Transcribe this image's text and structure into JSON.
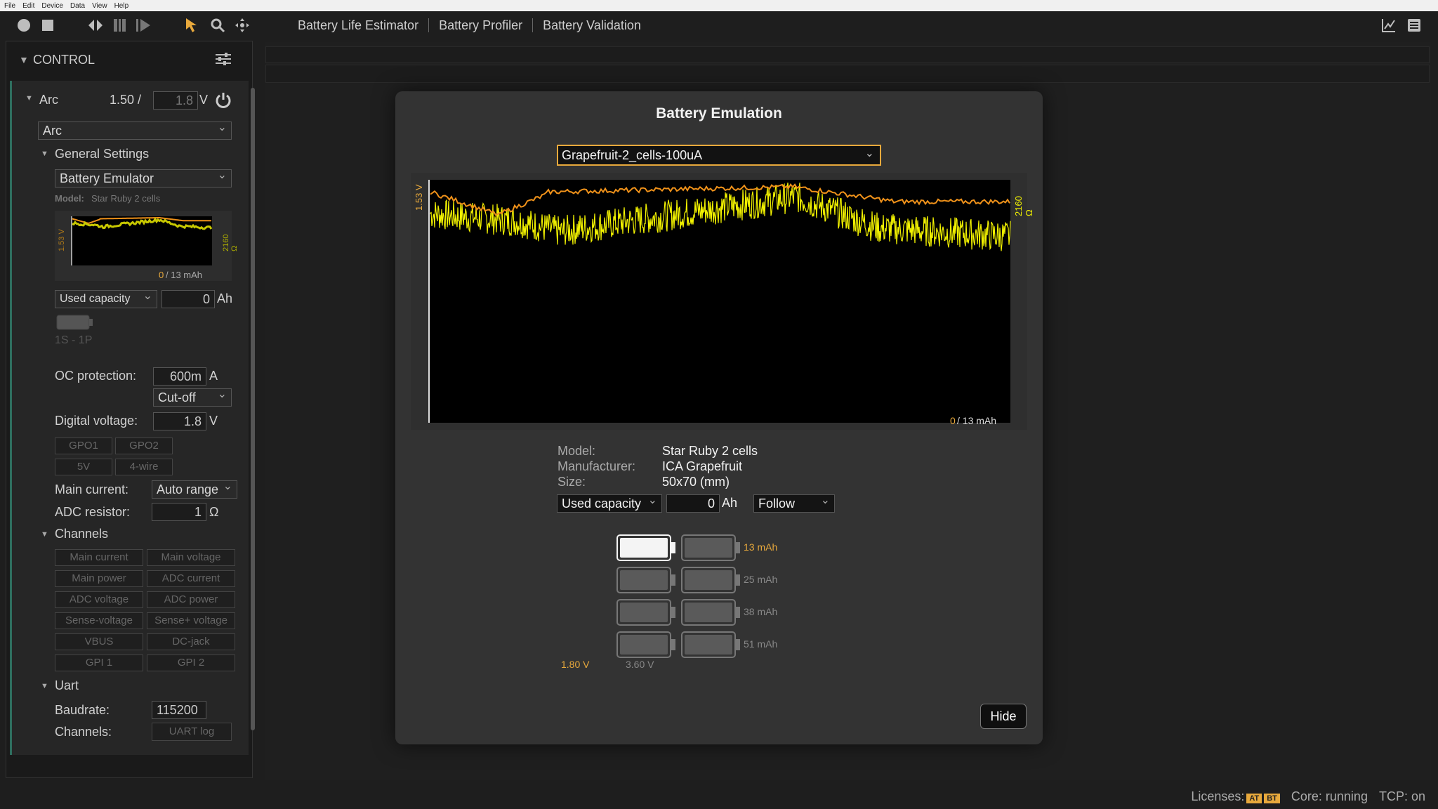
{
  "menu": [
    "File",
    "Edit",
    "Device",
    "Data",
    "View",
    "Help"
  ],
  "tabs": [
    "Battery Life Estimator",
    "Battery Profiler",
    "Battery Validation"
  ],
  "sidebar": {
    "title": "CONTROL",
    "arc_label": "Arc",
    "arc_value": "1.50 /",
    "arc_setpoint": "1.8",
    "arc_unit": "V",
    "arc_mode": "Arc",
    "general_settings": "General Settings",
    "emulator_mode": "Battery Emulator",
    "model_label": "Model:",
    "model_value": "Star Ruby 2 cells",
    "mini_left_axis": "1.53 V",
    "mini_right_axis": "2160 Ω",
    "mini_cap_used": "0",
    "mini_cap_total": "/ 13 mAh",
    "capacity_mode": "Used capacity",
    "capacity_value": "0",
    "capacity_unit": "Ah",
    "config": "1S - 1P",
    "oc_label": "OC protection:",
    "oc_value": "600m",
    "oc_unit": "A",
    "oc_mode": "Cut-off",
    "dv_label": "Digital voltage:",
    "dv_value": "1.8",
    "dv_unit": "V",
    "gpo_buttons": [
      "GPO1",
      "GPO2",
      "5V",
      "4-wire"
    ],
    "main_current_label": "Main current:",
    "main_current_value": "Auto range",
    "adc_label": "ADC resistor:",
    "adc_value": "1",
    "adc_unit": "Ω",
    "channels_title": "Channels",
    "channel_buttons": [
      "Main current",
      "Main voltage",
      "Main power",
      "ADC current",
      "ADC voltage",
      "ADC power",
      "Sense-voltage",
      "Sense+ voltage",
      "VBUS",
      "DC-jack",
      "GPI 1",
      "GPI 2"
    ],
    "uart_title": "Uart",
    "baud_label": "Baudrate:",
    "baud_value": "115200",
    "uart_channels_label": "Channels:",
    "uart_log": "UART log"
  },
  "dialog": {
    "title": "Battery Emulation",
    "profile": "Grapefruit-2_cells-100uA",
    "left_axis": "1.53 V",
    "right_axis": "2160 Ω",
    "cap_used": "0",
    "cap_total": "/ 13 mAh",
    "info_labels": [
      "Model:",
      "Manufacturer:",
      "Size:"
    ],
    "info_values": [
      "Star Ruby 2 cells",
      "ICA Grapefruit",
      "50x70 (mm)"
    ],
    "capacity_mode": "Used capacity",
    "capacity_value": "0",
    "capacity_unit": "Ah",
    "follow": "Follow",
    "row_caps": [
      "13 mAh",
      "25 mAh",
      "38 mAh",
      "51 mAh"
    ],
    "col_voltages": [
      "1.80 V",
      "3.60 V"
    ],
    "hide": "Hide"
  },
  "status": {
    "licenses": "Licenses:",
    "lic_a": "AT",
    "lic_b": "BT",
    "core": "Core: running",
    "tcp": "TCP: on"
  },
  "colors": {
    "accent": "#e8a93c",
    "voltage_trace": "#f0921a",
    "resistance_trace": "#f2f200"
  }
}
